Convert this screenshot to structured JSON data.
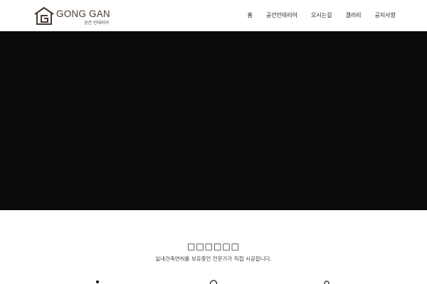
{
  "header": {
    "logo": {
      "name": "GONG GAN",
      "sub": "공간 인테리어"
    },
    "nav": [
      {
        "label": "홈"
      },
      {
        "label": "공간인테리어"
      },
      {
        "label": "오시는길"
      },
      {
        "label": "갤러리"
      },
      {
        "label": "공지사항"
      }
    ]
  },
  "hero": {
    "background": "#0b0b0b"
  },
  "intro": {
    "title": "□□□□□□",
    "subtitle": "실내건축면허를 보유중인 전문가가 직접 시공합니다."
  },
  "colors": {
    "brand": "#4a3b34",
    "text": "#222222"
  }
}
